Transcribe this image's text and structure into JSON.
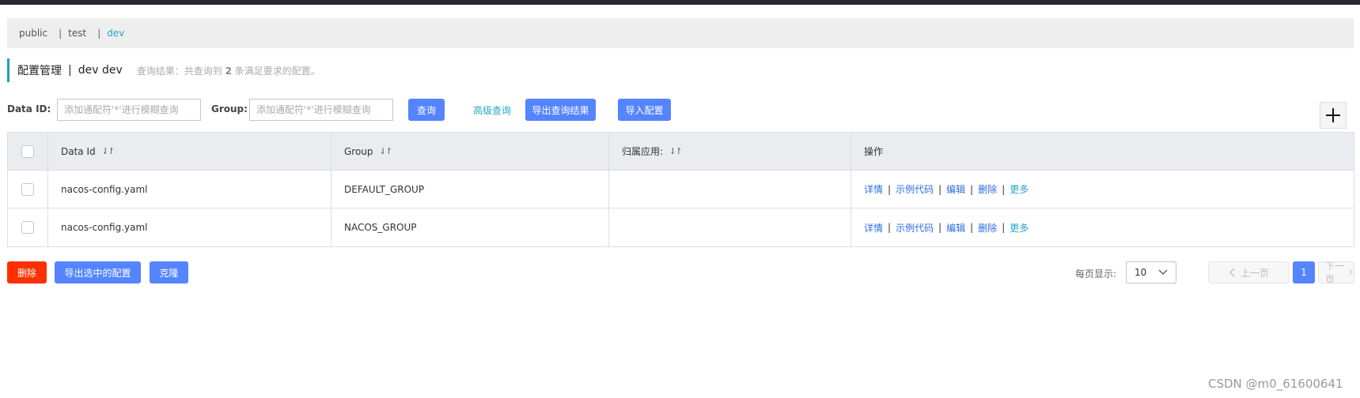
{
  "namespaces": [
    {
      "label": "public",
      "active": false
    },
    {
      "label": "test",
      "active": false
    },
    {
      "label": "dev",
      "active": true
    }
  ],
  "namespace_separator": "|",
  "header": {
    "title": "配置管理",
    "separator": "|",
    "namespace": "dev  dev",
    "result_prefix": "查询结果：共查询到 ",
    "result_count": "2",
    "result_suffix": " 条满足要求的配置。"
  },
  "search": {
    "data_id_label": "Data ID:",
    "data_id_placeholder": "添加通配符'*'进行模糊查询",
    "group_label": "Group:",
    "group_placeholder": "添加通配符'*'进行模糊查询",
    "query_button": "查询",
    "advanced_link": "高级查询",
    "export_results_button": "导出查询结果",
    "import_button": "导入配置"
  },
  "table": {
    "columns": [
      "Data Id",
      "Group",
      "归属应用:",
      "操作"
    ],
    "sort_icon": "⇃↾",
    "rows": [
      {
        "data_id": "nacos-config.yaml",
        "group": "DEFAULT_GROUP",
        "app": ""
      },
      {
        "data_id": "nacos-config.yaml",
        "group": "NACOS_GROUP",
        "app": ""
      }
    ],
    "actions": {
      "detail": "详情",
      "sample_code": "示例代码",
      "edit": "编辑",
      "delete": "删除",
      "more": "更多",
      "separator": "|"
    }
  },
  "footer": {
    "delete_button": "删除",
    "export_selected_button": "导出选中的配置",
    "clone_button": "克隆",
    "page_size_label": "每页显示:",
    "page_size_value": "10",
    "prev_page": "上一页",
    "current_page": "1",
    "next_page": "下一页"
  },
  "watermark": "CSDN @m0_61600641",
  "colors": {
    "primary": "#5584ff",
    "danger": "#ff3000",
    "link": "#26a5c8",
    "action_link": "#2b6de0",
    "topbar": "#262a31"
  }
}
